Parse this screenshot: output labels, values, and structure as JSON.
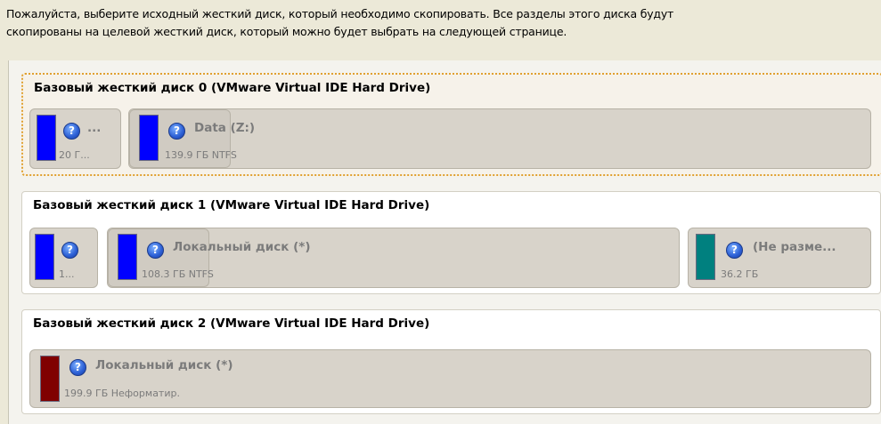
{
  "intro": {
    "line1": "Пожалуйста, выберите исходный жесткий диск, который необходимо скопировать. Все разделы этого диска будут",
    "line2": "скопированы на целевой жесткий диск, который можно будет выбрать на следующей странице."
  },
  "disks": [
    {
      "title": "Базовый жесткий диск 0 (VMware Virtual IDE Hard Drive)",
      "partitions": [
        {
          "name": "...",
          "info": "20 Г..."
        },
        {
          "name": "Data (Z:)",
          "info": "139.9 ГБ NTFS"
        }
      ]
    },
    {
      "title": "Базовый жесткий диск 1 (VMware Virtual IDE Hard Drive)",
      "partitions": [
        {
          "name": "",
          "info": "1..."
        },
        {
          "name": "Локальный диск (*)",
          "info": "108.3 ГБ NTFS"
        },
        {
          "name": "(Не разме...",
          "info": "36.2 ГБ"
        }
      ]
    },
    {
      "title": "Базовый жесткий диск 2 (VMware Virtual IDE Hard Drive)",
      "partitions": [
        {
          "name": "Локальный диск (*)",
          "info": "199.9 ГБ Неформатир."
        }
      ]
    }
  ],
  "colors": {
    "primary_partition": "#0000ff",
    "unallocated": "#00807f",
    "unformatted": "#800000",
    "selection_border": "#e0a030"
  },
  "icons": {
    "partition_help": "question-mark-icon"
  }
}
